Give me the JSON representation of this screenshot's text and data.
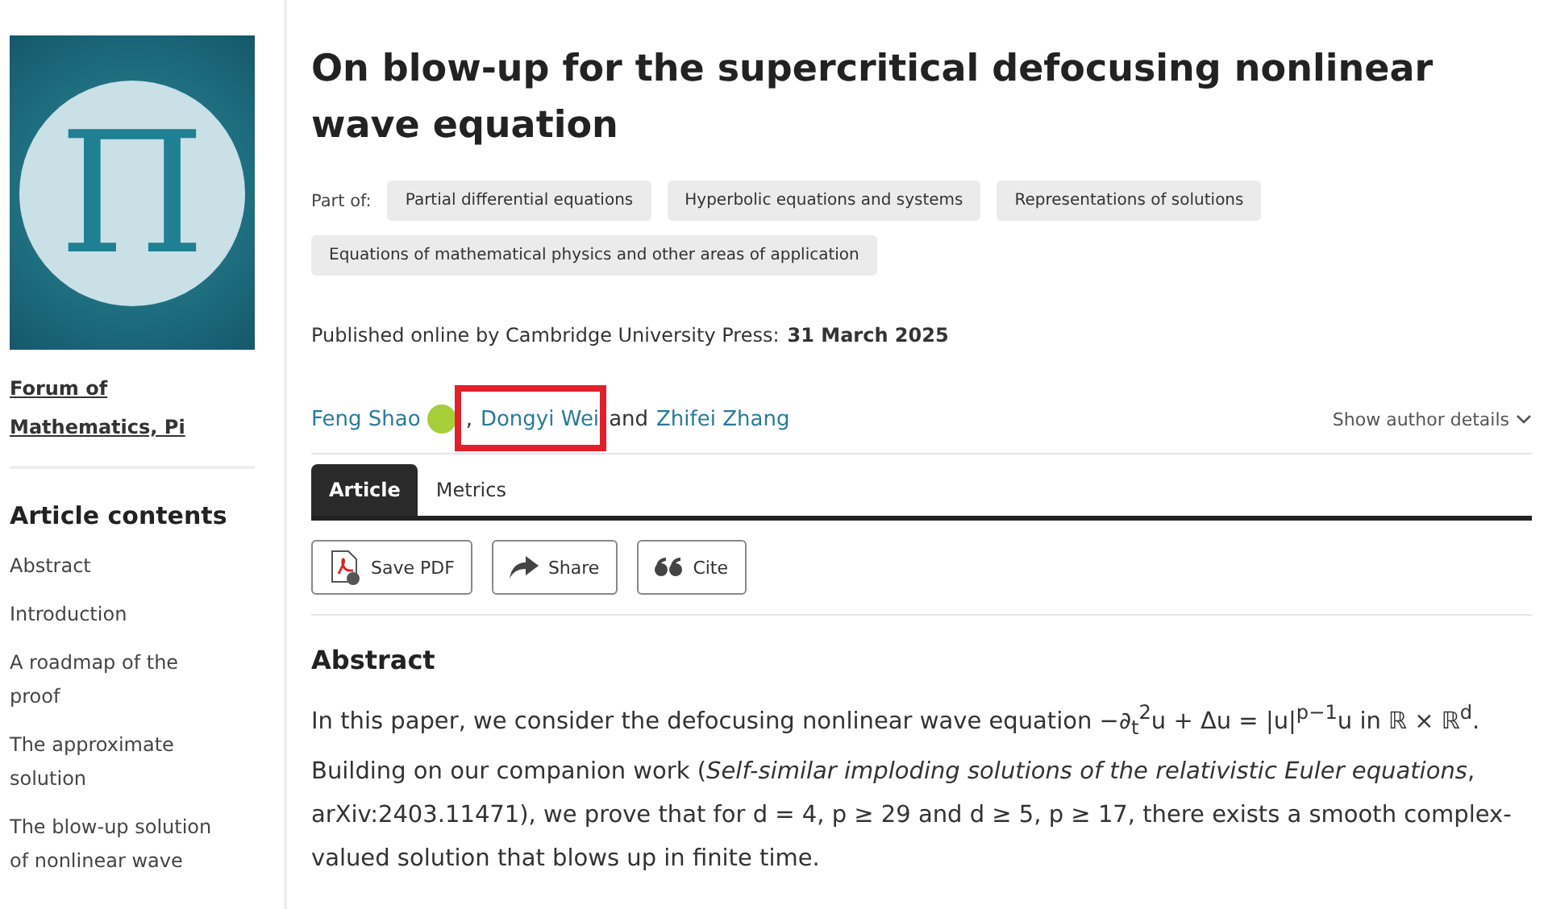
{
  "sidebar": {
    "cover": {
      "logo": "Π"
    },
    "journal": "Forum of Mathematics, Pi",
    "contents_title": "Article contents",
    "contents": [
      "Abstract",
      "Introduction",
      "A roadmap of the proof",
      "The approximate solution",
      "The blow-up solution of nonlinear wave"
    ]
  },
  "article": {
    "title": "On blow-up for the supercritical defocusing nonlinear wave equation",
    "part_of_label": "Part of:",
    "subjects": [
      "Partial differential equations",
      "Hyperbolic equations and systems",
      "Representations of solutions",
      "Equations of mathematical physics and other areas of application"
    ],
    "published_label": "Published online by Cambridge University Press:",
    "published_date": "31 March 2025",
    "authors": [
      {
        "name": "Feng Shao",
        "orcid": true,
        "separator": ","
      },
      {
        "name": "Dongyi Wei",
        "separator": "and",
        "highlighted": true
      },
      {
        "name": "Zhifei Zhang"
      }
    ],
    "author_details": "Show author details",
    "tabs": [
      {
        "label": "Article",
        "selected": true
      },
      {
        "label": "Metrics",
        "selected": false
      }
    ],
    "actions": [
      {
        "kind": "pdf",
        "label": "Save PDF"
      },
      {
        "kind": "share",
        "label": "Share"
      },
      {
        "kind": "cite",
        "label": "Cite"
      }
    ],
    "abstract_title": "Abstract",
    "abstract": "In this paper, we consider the defocusing nonlinear wave equation −∂$_{t}$$^{2}$u + Δu = |u|$^{p−1}$u in ℝ × ℝ$^{d}$. Building on our companion work (*Self-similar imploding solutions of the relativistic Euler equations*, arXiv:2403.11471), we prove that for d = 4, p ≥ 29 and d ≥ 5, p ≥ 17, there exists a smooth complex-valued solution that blows up in finite time."
  }
}
